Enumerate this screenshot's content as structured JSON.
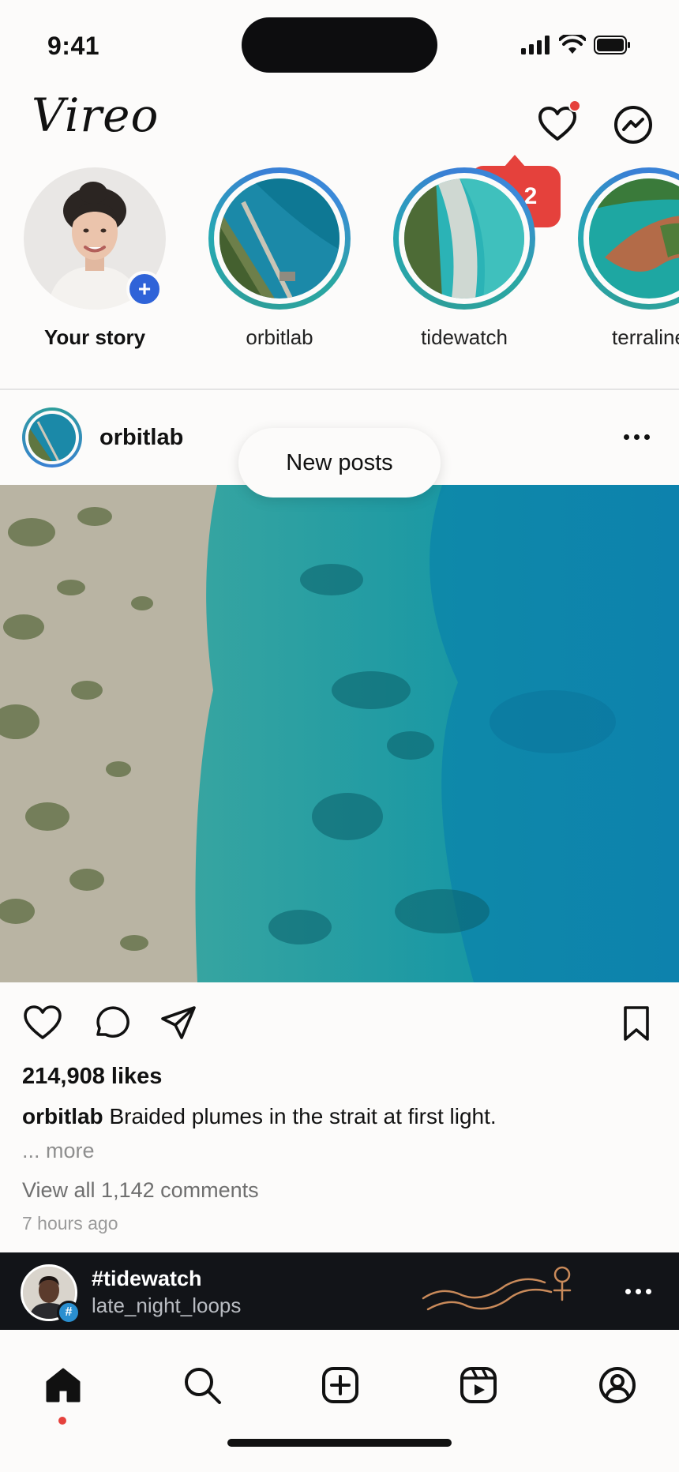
{
  "status_bar": {
    "time": "9:41"
  },
  "header": {
    "logo": "Vireo",
    "icons": [
      "heart-icon",
      "messenger-icon"
    ],
    "notification_dot": true
  },
  "notification_bubble": {
    "icon": "person-icon",
    "count": "2"
  },
  "stories": [
    {
      "label": "Your story",
      "is_own": true
    },
    {
      "label": "orbitlab"
    },
    {
      "label": "tidewatch"
    },
    {
      "label": "terraline"
    }
  ],
  "new_posts_pill": "New posts",
  "post": {
    "username": "orbitlab",
    "likes": "214,908 likes",
    "caption_user": "orbitlab",
    "caption_text": " Braided plumes in the strait at first light.",
    "more": "... more",
    "comments": "View all 1,142 comments",
    "time_ago": "7 hours ago"
  },
  "mini_player": {
    "title": "#tidewatch",
    "subtitle": "late_night_loops",
    "badge": "#"
  },
  "tab_bar": {
    "items": [
      "home-icon",
      "search-icon",
      "create-icon",
      "reels-icon",
      "profile-icon"
    ],
    "active": "home-icon"
  },
  "colors": {
    "accent_red": "#e5413c",
    "story_ring": "#2d9e9a",
    "badge_blue": "#2f63d8",
    "player_bg": "#121418"
  }
}
